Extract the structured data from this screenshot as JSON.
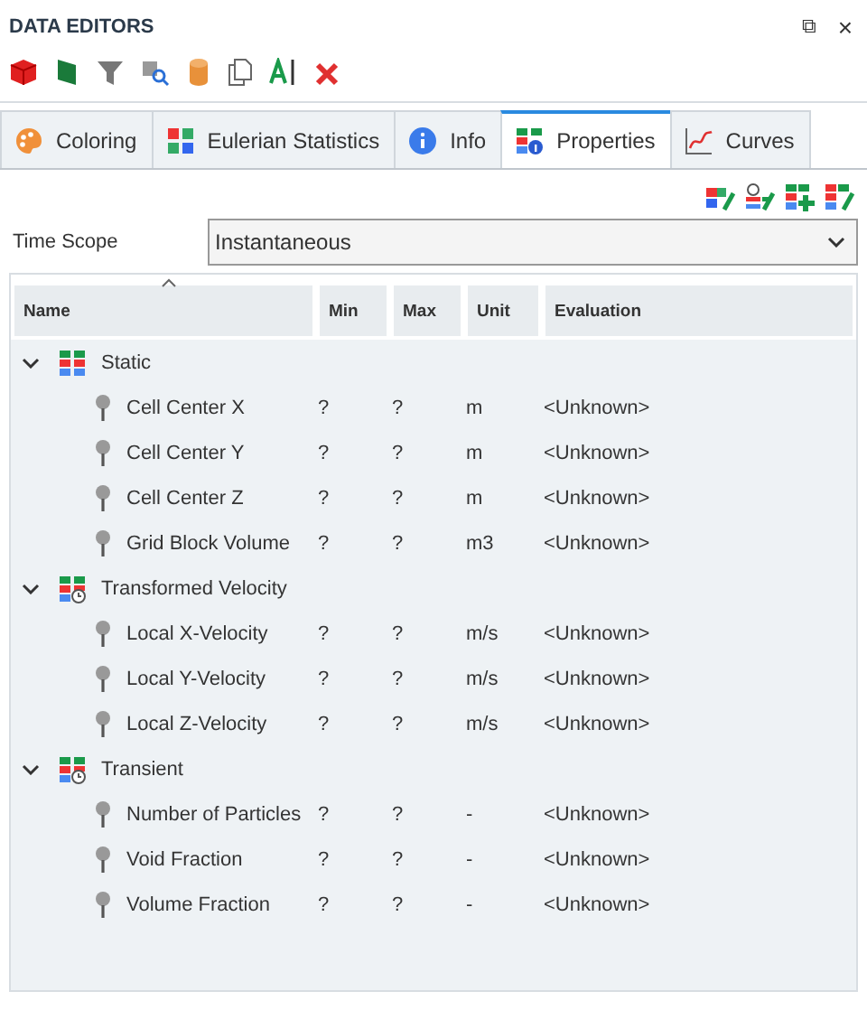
{
  "panel": {
    "title": "DATA EDITORS",
    "restore_glyph": "⧉",
    "close_glyph": "×"
  },
  "tabs": [
    {
      "label": "Coloring",
      "selected": false
    },
    {
      "label": "Eulerian Statistics",
      "selected": false
    },
    {
      "label": "Info",
      "selected": false
    },
    {
      "label": "Properties",
      "selected": true
    },
    {
      "label": "Curves",
      "selected": false
    }
  ],
  "time_scope": {
    "label": "Time Scope",
    "value": "Instantaneous"
  },
  "table": {
    "columns": [
      "Name",
      "Min",
      "Max",
      "Unit",
      "Evaluation"
    ],
    "rows": [
      {
        "name": "Static",
        "kind": "static",
        "expanded": true,
        "children": [
          {
            "name": "Cell Center X",
            "min": "?",
            "max": "?",
            "unit": "m",
            "evaluation": "<Unknown>"
          },
          {
            "name": "Cell Center Y",
            "min": "?",
            "max": "?",
            "unit": "m",
            "evaluation": "<Unknown>"
          },
          {
            "name": "Cell Center Z",
            "min": "?",
            "max": "?",
            "unit": "m",
            "evaluation": "<Unknown>"
          },
          {
            "name": "Grid Block Volume",
            "min": "?",
            "max": "?",
            "unit": "m3",
            "evaluation": "<Unknown>"
          }
        ]
      },
      {
        "name": "Transformed Velocity",
        "kind": "timed",
        "expanded": true,
        "children": [
          {
            "name": "Local X-Velocity",
            "min": "?",
            "max": "?",
            "unit": "m/s",
            "evaluation": "<Unknown>"
          },
          {
            "name": "Local Y-Velocity",
            "min": "?",
            "max": "?",
            "unit": "m/s",
            "evaluation": "<Unknown>"
          },
          {
            "name": "Local Z-Velocity",
            "min": "?",
            "max": "?",
            "unit": "m/s",
            "evaluation": "<Unknown>"
          }
        ]
      },
      {
        "name": "Transient",
        "kind": "timed",
        "expanded": true,
        "children": [
          {
            "name": "Number of Particles",
            "min": "?",
            "max": "?",
            "unit": "-",
            "evaluation": "<Unknown>"
          },
          {
            "name": "Void Fraction",
            "min": "?",
            "max": "?",
            "unit": "-",
            "evaluation": "<Unknown>"
          },
          {
            "name": "Volume Fraction",
            "min": "?",
            "max": "?",
            "unit": "-",
            "evaluation": "<Unknown>"
          }
        ]
      }
    ]
  }
}
